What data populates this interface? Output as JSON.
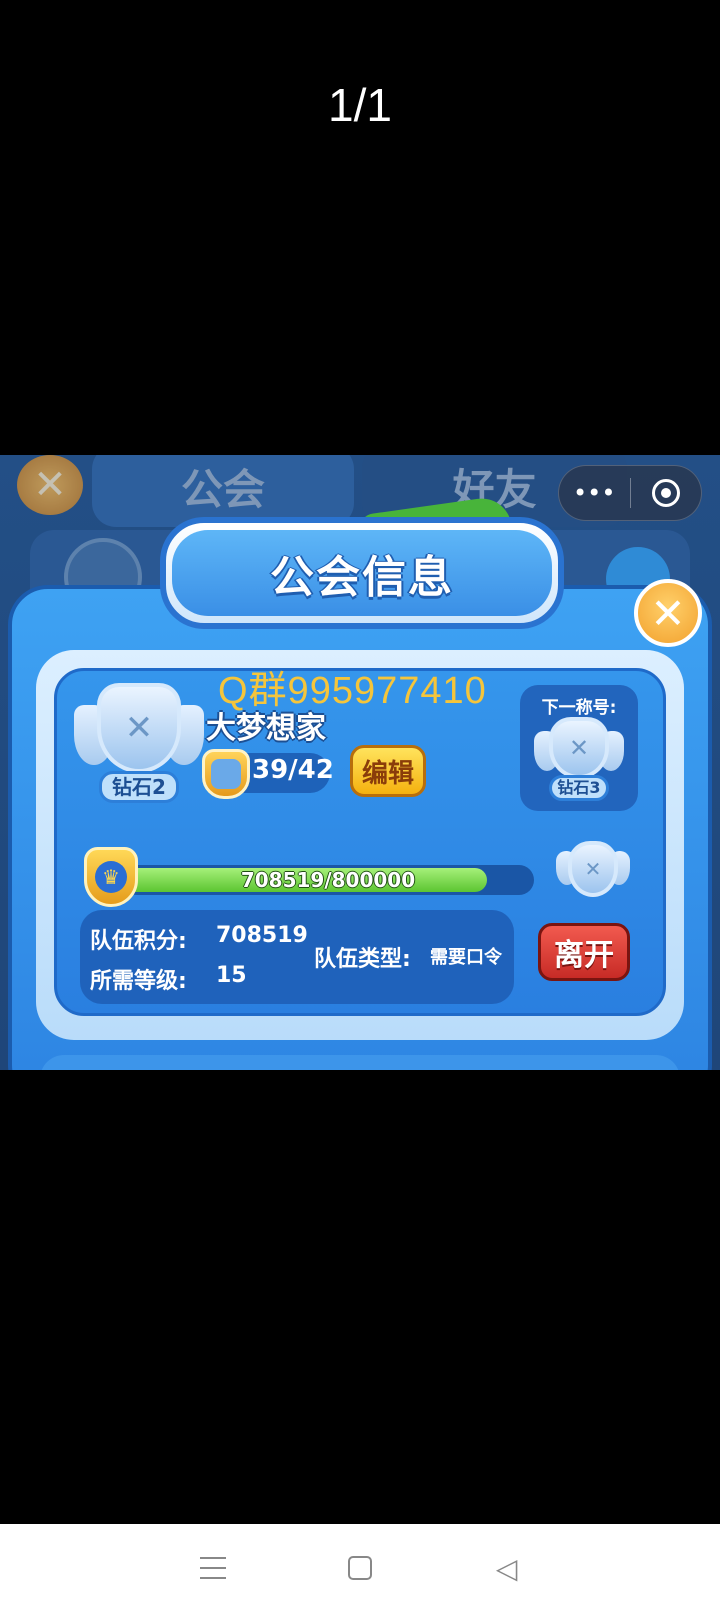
{
  "viewer": {
    "counter": "1/1"
  },
  "background": {
    "tabs": [
      "公会",
      "好友"
    ],
    "close_glyph": "✕"
  },
  "capsule": {
    "more_glyph": "•••"
  },
  "dialog": {
    "title": "公会信息",
    "close_glyph": "✕",
    "watermark": "Q群995977410",
    "guild_name": "大梦想家",
    "rank": "钻石2",
    "members": "39/42",
    "edit_label": "编辑",
    "next_title_label": "下一称号:",
    "next_rank": "钻石3",
    "progress": {
      "text": "708519/800000",
      "current": 708519,
      "max": 800000
    },
    "stats": {
      "team_score_label": "队伍积分:",
      "team_score_value": "708519",
      "required_level_label": "所需等级:",
      "required_level_value": "15",
      "team_type_label": "队伍类型:",
      "team_type_value": "需要口令"
    },
    "leave_label": "离开"
  },
  "icons": {
    "close": "close-icon",
    "menu": "menu-icon",
    "members": "members-icon",
    "crown": "crown-icon",
    "emblem": "guild-emblem-icon"
  },
  "colors": {
    "accent_blue": "#2d84e2",
    "progress_green": "#5cc531",
    "leave_red": "#c72b26",
    "edit_yellow": "#f5b10f",
    "watermark": "#f5c53b"
  }
}
